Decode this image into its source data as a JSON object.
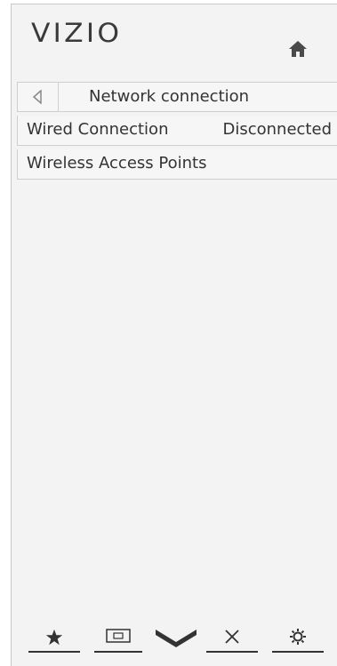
{
  "brand": {
    "logo_text": "VIZIO"
  },
  "header": {
    "home_icon": "home-icon"
  },
  "nav": {
    "back_icon": "back-triangle-icon",
    "title": "Network connection"
  },
  "menu": {
    "items": [
      {
        "label": "Wired Connection",
        "value": "Disconnected"
      },
      {
        "label": "Wireless Access Points",
        "value": ""
      }
    ]
  },
  "bottom_bar": {
    "items": [
      {
        "icon": "star-icon"
      },
      {
        "icon": "input-screen-icon"
      },
      {
        "icon": "vizio-v-icon"
      },
      {
        "icon": "close-icon"
      },
      {
        "icon": "gear-icon"
      }
    ]
  },
  "colors": {
    "panel_bg": "#f3f3f3",
    "text": "#333333",
    "border": "#cfcfcf"
  }
}
